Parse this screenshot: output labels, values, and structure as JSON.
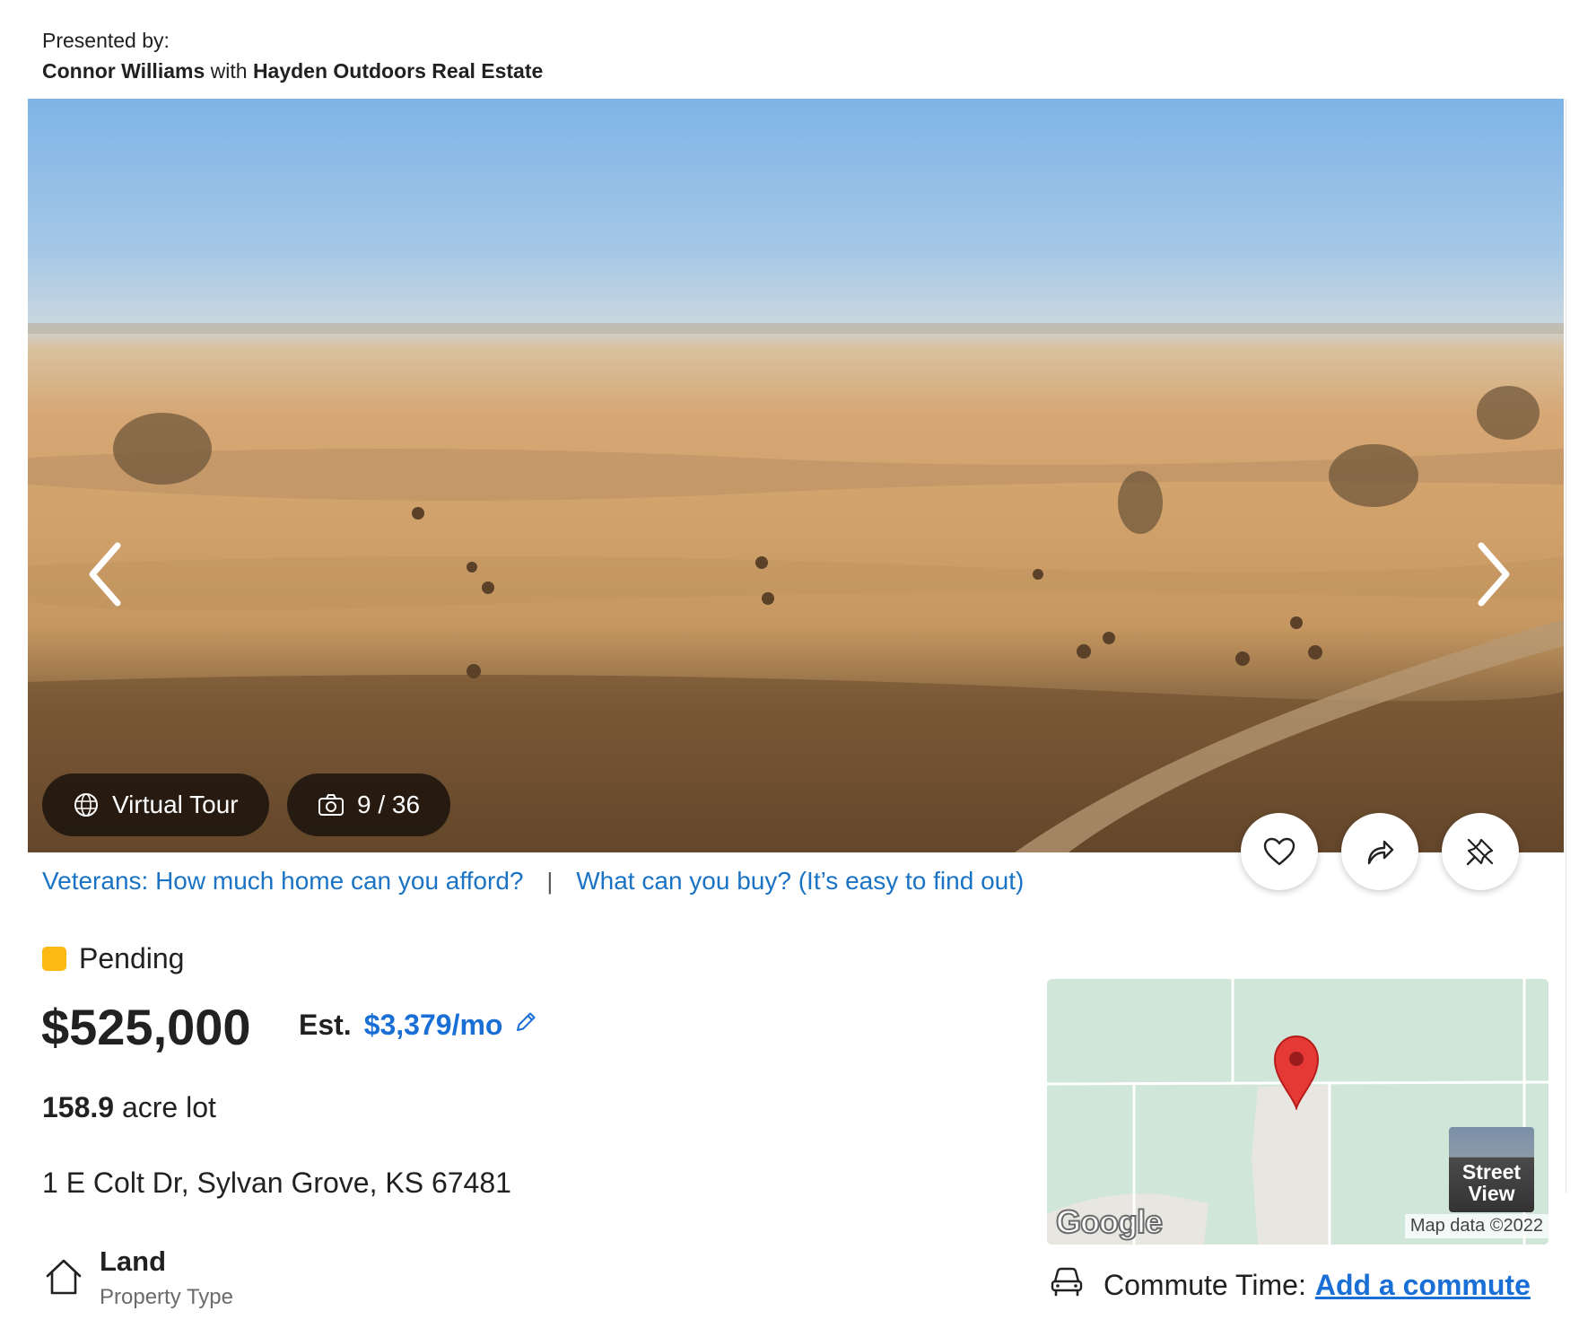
{
  "presented": {
    "label": "Presented by:",
    "agent": "Connor Williams",
    "with": "with",
    "brokerage": "Hayden Outdoors Real Estate"
  },
  "gallery": {
    "virtual_tour_label": "Virtual Tour",
    "photo_counter": "9 / 36"
  },
  "promo": {
    "link1": "Veterans: How much home can you afford?",
    "separator": "|",
    "link2": "What can you buy? (It’s easy to find out)"
  },
  "listing": {
    "status": "Pending",
    "status_color": "#fdb913",
    "price": "$525,000",
    "est_label": "Est.",
    "est_payment": "$3,379/mo",
    "lot_size": "158.9",
    "lot_unit": "acre lot",
    "address": "1 E Colt Dr, Sylvan Grove, KS 67481",
    "property_type_value": "Land",
    "property_type_label": "Property Type"
  },
  "map": {
    "street_view_line1": "Street",
    "street_view_line2": "View",
    "logo": "Google",
    "credit": "Map data ©2022"
  },
  "commute": {
    "label": "Commute Time:",
    "link": "Add a commute"
  },
  "colors": {
    "link": "#1a73c5",
    "accent": "#1a6fd6",
    "pin": "#e53935"
  },
  "icons": {
    "prev": "chevron-left-icon",
    "next": "chevron-right-icon",
    "tour": "globe-www-icon",
    "photos": "camera-icon",
    "favorite": "heart-icon",
    "share": "share-arrow-icon",
    "hide": "hide-pin-icon",
    "edit": "pencil-icon",
    "property_type": "house-icon",
    "commute": "car-icon",
    "map_marker": "map-pin-icon"
  }
}
